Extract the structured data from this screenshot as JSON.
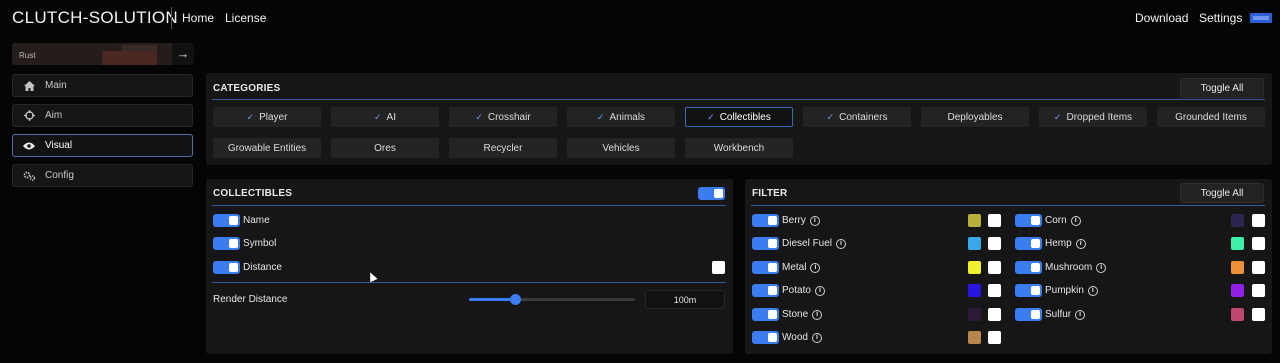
{
  "header": {
    "brand": "CLUTCH-SOLUTION",
    "nav_left": [
      "Home",
      "License"
    ],
    "nav_right": [
      "Download",
      "Settings"
    ]
  },
  "game_card": {
    "label": "Rust",
    "arrow": "→"
  },
  "sidebar": {
    "items": [
      {
        "label": "Main",
        "icon": "home-icon",
        "active": false
      },
      {
        "label": "Aim",
        "icon": "crosshair-icon",
        "active": false
      },
      {
        "label": "Visual",
        "icon": "eye-icon",
        "active": true
      },
      {
        "label": "Config",
        "icon": "gears-icon",
        "active": false
      }
    ]
  },
  "categories": {
    "title": "CATEGORIES",
    "toggle_all": "Toggle All",
    "buttons": [
      {
        "label": "Player",
        "checked": true,
        "selected": false
      },
      {
        "label": "AI",
        "checked": true,
        "selected": false
      },
      {
        "label": "Crosshair",
        "checked": true,
        "selected": false
      },
      {
        "label": "Animals",
        "checked": true,
        "selected": false
      },
      {
        "label": "Collectibles",
        "checked": true,
        "selected": true
      },
      {
        "label": "Containers",
        "checked": true,
        "selected": false
      },
      {
        "label": "Deployables",
        "checked": false,
        "selected": false
      },
      {
        "label": "Dropped Items",
        "checked": true,
        "selected": false
      },
      {
        "label": "Grounded Items",
        "checked": false,
        "selected": false
      },
      {
        "label": "Growable Entities",
        "checked": false,
        "selected": false
      },
      {
        "label": "Ores",
        "checked": false,
        "selected": false
      },
      {
        "label": "Recycler",
        "checked": false,
        "selected": false
      },
      {
        "label": "Vehicles",
        "checked": false,
        "selected": false
      },
      {
        "label": "Workbench",
        "checked": false,
        "selected": false
      }
    ]
  },
  "collectibles": {
    "title": "COLLECTIBLES",
    "master_toggle": true,
    "options": [
      {
        "label": "Name",
        "enabled": true
      },
      {
        "label": "Symbol",
        "enabled": true
      },
      {
        "label": "Distance",
        "enabled": true
      }
    ],
    "render_distance": {
      "label": "Render Distance",
      "value": "100m",
      "fraction": 0.28
    }
  },
  "filter": {
    "title": "FILTER",
    "toggle_all": "Toggle All",
    "left": [
      {
        "label": "Berry",
        "color": "#b8b03a"
      },
      {
        "label": "Diesel Fuel",
        "color": "#38a8e8"
      },
      {
        "label": "Metal",
        "color": "#f0f030"
      },
      {
        "label": "Potato",
        "color": "#2a14e0"
      },
      {
        "label": "Stone",
        "color": "#2a1a38"
      },
      {
        "label": "Wood",
        "color": "#b8864c"
      }
    ],
    "right": [
      {
        "label": "Corn",
        "color": "#2e2450"
      },
      {
        "label": "Hemp",
        "color": "#3ef0a8"
      },
      {
        "label": "Mushroom",
        "color": "#f09038"
      },
      {
        "label": "Pumpkin",
        "color": "#9020e8"
      },
      {
        "label": "Sulfur",
        "color": "#c04870"
      }
    ]
  }
}
